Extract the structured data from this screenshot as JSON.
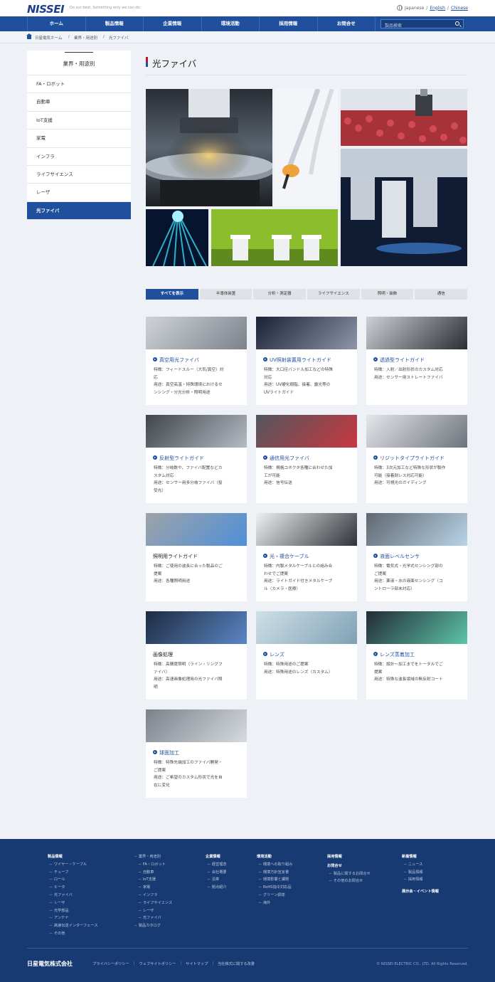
{
  "header": {
    "logo": "NISSEI",
    "tagline": "Do our best. Something only we can do.",
    "lang_current": "Japanese",
    "lang_links": [
      "English",
      "Chinese"
    ]
  },
  "nav": {
    "items": [
      "ホーム",
      "製品情報",
      "企業情報",
      "環境活動",
      "採用情報",
      "お問合せ"
    ],
    "search_placeholder": "製品検索"
  },
  "breadcrumb": [
    "日星電気ホーム",
    "業界・用途別",
    "光ファイバ"
  ],
  "sidebar": {
    "heading": "業界・用途別",
    "items": [
      "FA・ロボット",
      "自動車",
      "IoT支援",
      "家電",
      "インフラ",
      "ライフサイエンス",
      "レーザ",
      "光ファイバ"
    ],
    "active_index": 7
  },
  "page": {
    "title": "光ファイバ"
  },
  "filter_tabs": [
    "すべてを表示",
    "半導体装置",
    "分析・測定器",
    "ライフサイエンス",
    "照明・装飾",
    "通信"
  ],
  "products": [
    {
      "name": "真空用光ファイバ",
      "link": true,
      "lines": [
        "特徴：フィードスルー（大気/真空）対",
        "応",
        "用途：真空高温・特殊環境におけるセ",
        "ンシング・分光分析・照明用途"
      ]
    },
    {
      "name": "UV照射装置用ライトガイド",
      "link": true,
      "lines": [
        "特徴：大口径バンドル加工などの特殊",
        "対応",
        "用途：UV硬化樹脂、接着、露光等の",
        "UVライトガイド"
      ]
    },
    {
      "name": "透過型ライトガイド",
      "link": true,
      "lines": [
        "特徴：入射／出射形状のカスタム対応",
        "用途：センサー用ストレートファイバ"
      ]
    },
    {
      "name": "反射型ライトガイド",
      "link": true,
      "lines": [
        "特徴：分岐数や、ファイバ配置などカ",
        "スタム対応",
        "用途：センサー用多分岐ファイバ（投",
        "受光）"
      ]
    },
    {
      "name": "通信用光ファイバ",
      "link": true,
      "lines": [
        "特徴：規格コネクタ各種に合わせた加",
        "工が可能",
        "用途：信号伝送"
      ]
    },
    {
      "name": "リジットタイプライトガイド",
      "link": true,
      "lines": [
        "特徴：3次元加工など特殊な形状が製作",
        "可能（接着剤レス対応可能）",
        "用途：可視光のガイディング"
      ]
    },
    {
      "name": "照明用ライトガイド",
      "link": false,
      "lines": [
        "特徴：ご使用の波長に合った製品のご",
        "提案",
        "用途：各種照明用途"
      ]
    },
    {
      "name": "光・複合ケーブル",
      "link": true,
      "lines": [
        "特徴：内製メタルケーブルとの組み合",
        "わせでご提案",
        "用途：ライトガイド付きメタルケーブ",
        "ル（カメラ・医療）"
      ]
    },
    {
      "name": "液面レベルセンサ",
      "link": true,
      "lines": [
        "特徴：電気式・光学式センシング部の",
        "ご提案",
        "用途：薬液・水の液面センシング（コ",
        "ントローラ部未対応）"
      ]
    },
    {
      "name": "画像処理",
      "link": false,
      "lines": [
        "特徴：高輝度照明（ライン・リングフ",
        "ァイバ）",
        "用途：高速画像処理用の光ファイバ照",
        "明"
      ]
    },
    {
      "name": "レンズ",
      "link": true,
      "lines": [
        "特徴：特殊用途のご提案",
        "用途：特殊用途のレンズ（カスタム）"
      ]
    },
    {
      "name": "レンズ蒸着加工",
      "link": true,
      "lines": [
        "特徴：設計〜加工までをトータルでご",
        "提案",
        "用途：特殊な波長領域の無反射コート"
      ]
    },
    {
      "name": "球面加工",
      "link": true,
      "lines": [
        "特徴：特殊先端加工のファイバ開発・",
        "ご提案",
        "用途：ご希望のカスタム形状で光を自",
        "在に変化"
      ]
    }
  ],
  "footer": {
    "col1": {
      "heading": "製品情報",
      "items": [
        "ワイヤー・ケーブル",
        "チューブ",
        "ロール",
        "ヒータ",
        "光ファイバ",
        "レーザ",
        "光学部品",
        "アンテナ",
        "高速伝送インターフェース",
        "その他"
      ]
    },
    "col2": {
      "heading": "業界・用途別",
      "items": [
        "FA・ロボット",
        "自動車",
        "IoT支援",
        "家電",
        "インフラ",
        "ライフサイエンス",
        "レーザ",
        "光ファイバ"
      ],
      "extra": "製品カタログ"
    },
    "col3": {
      "heading": "企業情報",
      "items": [
        "経営理念",
        "会社概要",
        "沿革",
        "拠点紹介"
      ]
    },
    "col4": {
      "heading": "環境活動",
      "items": [
        "環境への取り組み",
        "環境方針宣言書",
        "環境影響と課題",
        "RoHS指令対応品",
        "グリーン調達",
        "海外"
      ]
    },
    "col5": {
      "heading": "採用情報",
      "heading2": "お問合せ",
      "items": [
        "製品に関するお問合せ",
        "その他のお問合せ"
      ]
    },
    "col6": {
      "heading": "新着情報",
      "items": [
        "ニュース",
        "製品情報",
        "採用情報"
      ],
      "heading2": "展示会・イベント情報"
    },
    "brand": "日星電気株式会社",
    "links": [
      "プライバシーポリシー",
      "ウェブサイトポリシー",
      "サイトマップ",
      "当社株式に関する改書"
    ],
    "copyright": "© NISSEI ELECTRIC CO., LTD. All Rights Reserved."
  }
}
